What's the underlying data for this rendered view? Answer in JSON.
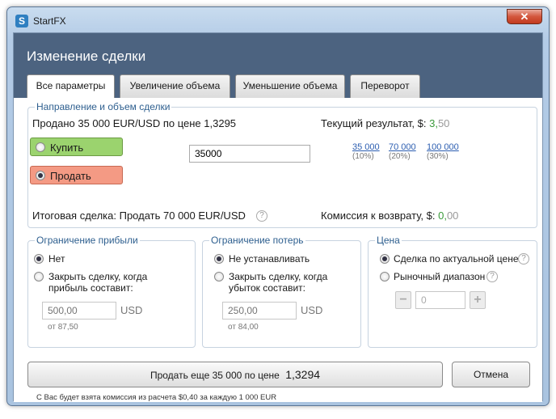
{
  "window": {
    "title": "StartFX",
    "close_glyph": "✕"
  },
  "header": {
    "title": "Изменение сделки"
  },
  "tabs": [
    {
      "label": "Все параметры",
      "active": true
    },
    {
      "label": "Увеличение объема"
    },
    {
      "label": "Уменьшение объема"
    },
    {
      "label": "Переворот"
    }
  ],
  "direction": {
    "legend": "Направление и объем сделки",
    "sold_text": "Продано 35 000 EUR/USD по цене 1,3295",
    "current_result_label": "Текущий результат, $:",
    "current_result_int": "3,",
    "current_result_frac": "50",
    "buy_label": "Купить",
    "sell_label": "Продать",
    "volume_value": "35000",
    "presets": [
      {
        "amount": "35 000",
        "pct": "(10%)"
      },
      {
        "amount": "70 000",
        "pct": "(20%)"
      },
      {
        "amount": "100 000",
        "pct": "(30%)"
      }
    ],
    "total_text": "Итоговая сделка: Продать 70 000 EUR/USD",
    "commission_label": "Комиссия к возврату, $:",
    "commission_int": "0,",
    "commission_frac": "00"
  },
  "take_profit": {
    "legend": "Ограничение прибыли",
    "option_none": "Нет",
    "option_close_line1": "Закрыть сделку, когда",
    "option_close_line2": "прибыль составит:",
    "placeholder": "500,00",
    "currency": "USD",
    "hint": "от 87,50"
  },
  "stop_loss": {
    "legend": "Ограничение потерь",
    "option_none": "Не устанавливать",
    "option_close_line1": "Закрыть сделку, когда",
    "option_close_line2": "убыток составит:",
    "placeholder": "250,00",
    "currency": "USD",
    "hint": "от 84,00"
  },
  "price": {
    "legend": "Цена",
    "option_market": "Сделка по актуальной цене",
    "option_range": "Рыночный диапазон",
    "range_value": "0",
    "minus": "−",
    "plus": "+"
  },
  "actions": {
    "submit_prefix": "Продать еще 35 000 по цене",
    "submit_price": "1,3294",
    "cancel": "Отмена"
  },
  "footer": {
    "commission_note": "С Вас будет взята комиссия из расчета $0,40 за каждую  1 000 EUR"
  },
  "icons": {
    "help": "?",
    "logo": "S"
  }
}
